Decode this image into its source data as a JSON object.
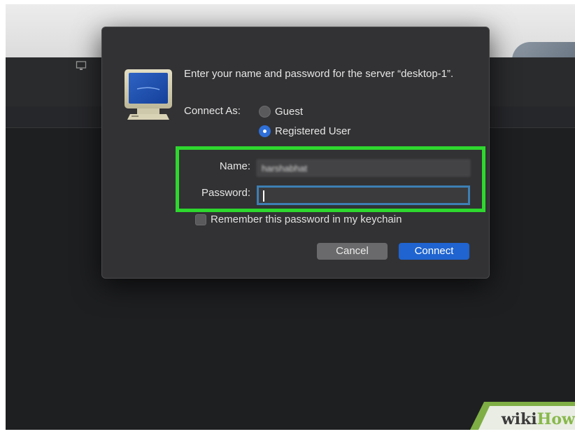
{
  "dialog": {
    "prompt": "Enter your name and password for the server “desktop-1”.",
    "connect_as_label": "Connect As:",
    "radio_guest": "Guest",
    "radio_registered": "Registered User",
    "selected_option": "Registered User",
    "name_label": "Name:",
    "name_value": "harshabhat",
    "password_label": "Password:",
    "password_value": "",
    "keychain_label": "Remember this password in my keychain",
    "keychain_checked": false,
    "cancel_label": "Cancel",
    "connect_label": "Connect"
  },
  "icons": {
    "server": "monitor-icon",
    "background_toolbar": "display-icon"
  },
  "colors": {
    "highlight": "#2ed82e",
    "primary_button": "#1f64d0",
    "dialog_bg": "#323234",
    "focus_ring": "#3d7fb3"
  },
  "watermark": {
    "wiki": "wiki",
    "how": "How"
  }
}
